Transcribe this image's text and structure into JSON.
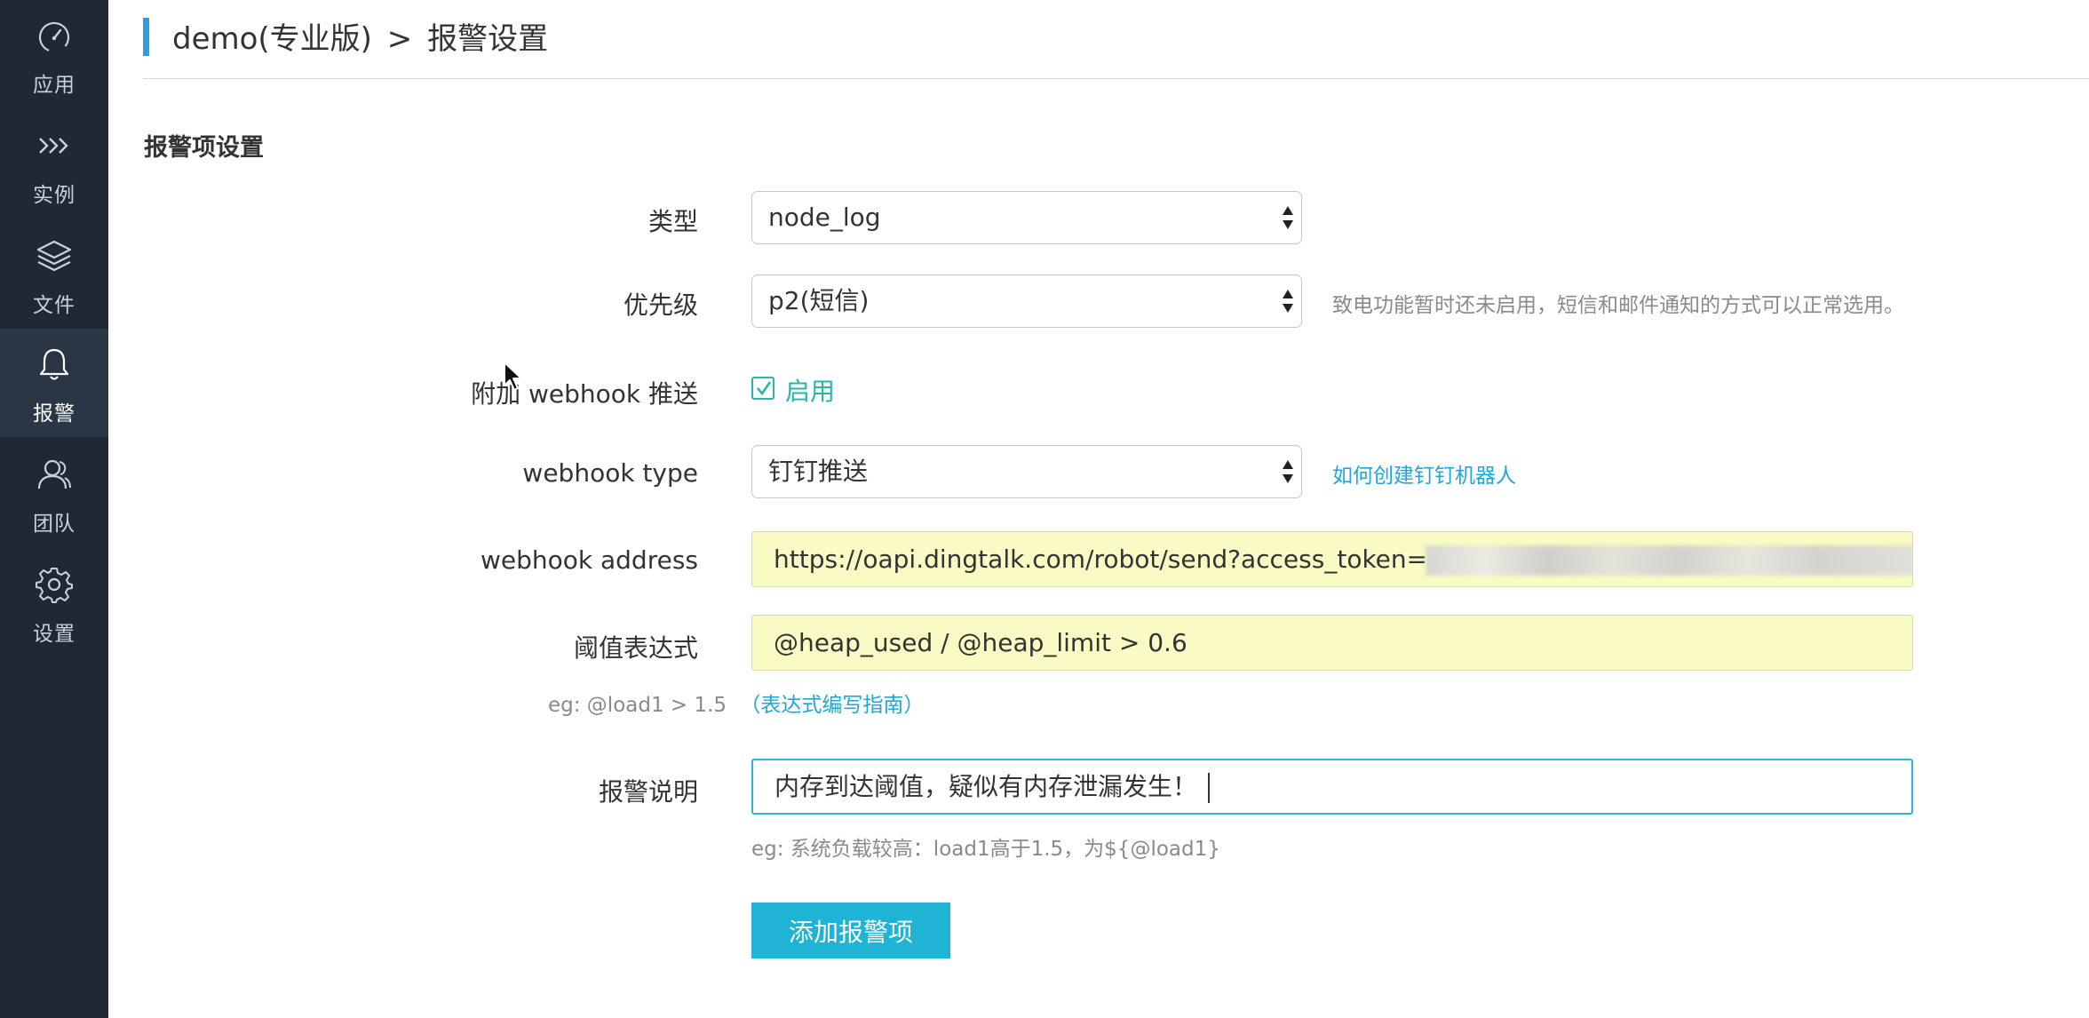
{
  "sidebar": {
    "items": [
      {
        "label": "应用",
        "icon": "dashboard-icon"
      },
      {
        "label": "实例",
        "icon": "chevrons-right-icon"
      },
      {
        "label": "文件",
        "icon": "layers-icon"
      },
      {
        "label": "报警",
        "icon": "bell-icon",
        "active": true
      },
      {
        "label": "团队",
        "icon": "team-icon"
      },
      {
        "label": "设置",
        "icon": "gear-icon"
      }
    ]
  },
  "header": {
    "app_name": "demo(专业版)",
    "separator": ">",
    "page_title": "报警设置"
  },
  "section": {
    "title": "报警项设置"
  },
  "form": {
    "type": {
      "label": "类型",
      "value": "node_log"
    },
    "priority": {
      "label": "优先级",
      "value": "p2(短信)",
      "hint": "致电功能暂时还未启用，短信和邮件通知的方式可以正常选用。"
    },
    "webhook_push": {
      "label": "附加 webhook 推送",
      "checked": true,
      "checkbox_label": "启用"
    },
    "webhook_type": {
      "label": "webhook type",
      "value": "钉钉推送",
      "link": "如何创建钉钉机器人"
    },
    "webhook_address": {
      "label": "webhook address",
      "value": "https://oapi.dingtalk.com/robot/send?access_token="
    },
    "threshold": {
      "label": "阈值表达式",
      "value": "@heap_used / @heap_limit > 0.6",
      "hint": "eg: @load1 > 1.5",
      "hint_link": "（表达式编写指南）"
    },
    "description": {
      "label": "报警说明",
      "value": "内存到达阈值，疑似有内存泄漏发生！",
      "hint": "eg: 系统负载较高：load1高于1.5，为${@load1}"
    },
    "submit_label": "添加报警项"
  },
  "colors": {
    "sidebar_bg": "#1f2936",
    "accent": "#1fb3d6",
    "header_bar": "#2d9fe0",
    "check": "#2bb5a8",
    "input_autofill": "#fafac4"
  }
}
